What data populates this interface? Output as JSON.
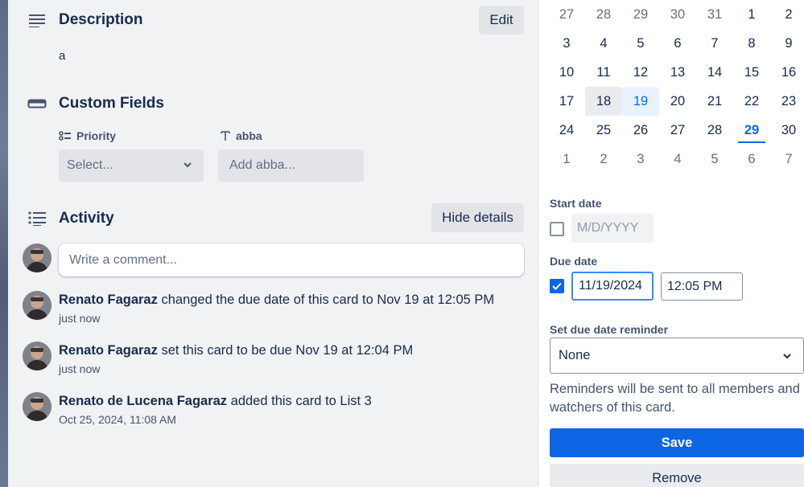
{
  "description": {
    "title": "Description",
    "edit_label": "Edit",
    "text": "a"
  },
  "custom_fields": {
    "title": "Custom Fields",
    "priority": {
      "label": "Priority",
      "placeholder": "Select..."
    },
    "abba": {
      "label": "abba",
      "placeholder": "Add abba..."
    }
  },
  "activity": {
    "title": "Activity",
    "hide_details_label": "Hide details",
    "comment_placeholder": "Write a comment...",
    "items": [
      {
        "user": "Renato Fagaraz",
        "action": "changed the due date of this card to Nov 19 at 12:05 PM",
        "time": "just now"
      },
      {
        "user": "Renato Fagaraz",
        "action": "set this card to be due Nov 19 at 12:04 PM",
        "time": "just now"
      },
      {
        "user": "Renato de Lucena Fagaraz",
        "action": "added this card to List 3",
        "time": "Oct 25, 2024, 11:08 AM"
      }
    ]
  },
  "calendar": {
    "weeks": [
      [
        "27",
        "28",
        "29",
        "30",
        "31",
        "1",
        "2"
      ],
      [
        "3",
        "4",
        "5",
        "6",
        "7",
        "8",
        "9"
      ],
      [
        "10",
        "11",
        "12",
        "13",
        "14",
        "15",
        "16"
      ],
      [
        "17",
        "18",
        "19",
        "20",
        "21",
        "22",
        "23"
      ],
      [
        "24",
        "25",
        "26",
        "27",
        "28",
        "29",
        "30"
      ],
      [
        "1",
        "2",
        "3",
        "4",
        "5",
        "6",
        "7"
      ]
    ]
  },
  "dates": {
    "start_label": "Start date",
    "start_placeholder": "M/D/YYYY",
    "start_checked": false,
    "due_label": "Due date",
    "due_checked": true,
    "due_date": "11/19/2024",
    "due_time": "12:05 PM",
    "reminder_label": "Set due date reminder",
    "reminder_value": "None",
    "reminder_note": "Reminders will be sent to all members and watchers of this card.",
    "save_label": "Save",
    "remove_label": "Remove"
  },
  "colors": {
    "accent": "#0c66e4",
    "text": "#172b4d",
    "subtle": "#44546f",
    "button_bg": "#e2e4e8"
  }
}
